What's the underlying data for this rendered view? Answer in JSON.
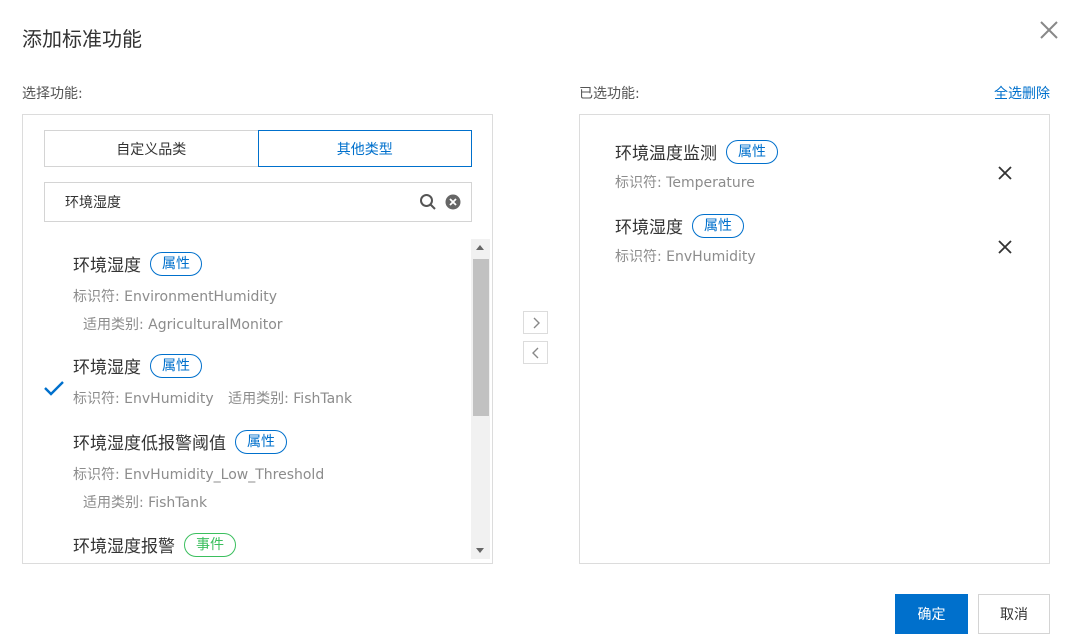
{
  "dialog": {
    "title": "添加标准功能"
  },
  "left": {
    "label": "选择功能:",
    "tabs": [
      {
        "label": "自定义品类",
        "active": false
      },
      {
        "label": "其他类型",
        "active": true
      }
    ],
    "search": {
      "value": "环境湿度",
      "placeholder": ""
    },
    "items": [
      {
        "name": "环境湿度",
        "tag": "属性",
        "identifier": "标识符: EnvironmentHumidity",
        "category": "适用类别: AgriculturalMonitor",
        "checked": false
      },
      {
        "name": "环境湿度",
        "tag": "属性",
        "identifier": "标识符: EnvHumidity",
        "category": "适用类别: FishTank",
        "checked": true
      },
      {
        "name": "环境湿度低报警阈值",
        "tag": "属性",
        "identifier": "标识符: EnvHumidity_Low_Threshold",
        "category": "适用类别: FishTank",
        "checked": false
      },
      {
        "name": "环境湿度报警",
        "tag": "事件",
        "identifier": "",
        "category": "",
        "checked": false
      }
    ]
  },
  "right": {
    "label": "已选功能:",
    "select_all_delete": "全选删除",
    "items": [
      {
        "name": "环境温度监测",
        "tag": "属性",
        "identifier": "标识符: Temperature"
      },
      {
        "name": "环境湿度",
        "tag": "属性",
        "identifier": "标识符: EnvHumidity"
      }
    ]
  },
  "footer": {
    "confirm": "确定",
    "cancel": "取消"
  },
  "colors": {
    "accent": "#0070cc",
    "event_tag": "#3bbf5e",
    "muted_text": "#8c8c8c"
  },
  "icons": {
    "close": "close-icon",
    "search": "search-icon",
    "clear": "clear-icon",
    "check": "check-icon",
    "move_right": "chevron-right-icon",
    "move_left": "chevron-left-icon",
    "remove": "remove-icon"
  }
}
